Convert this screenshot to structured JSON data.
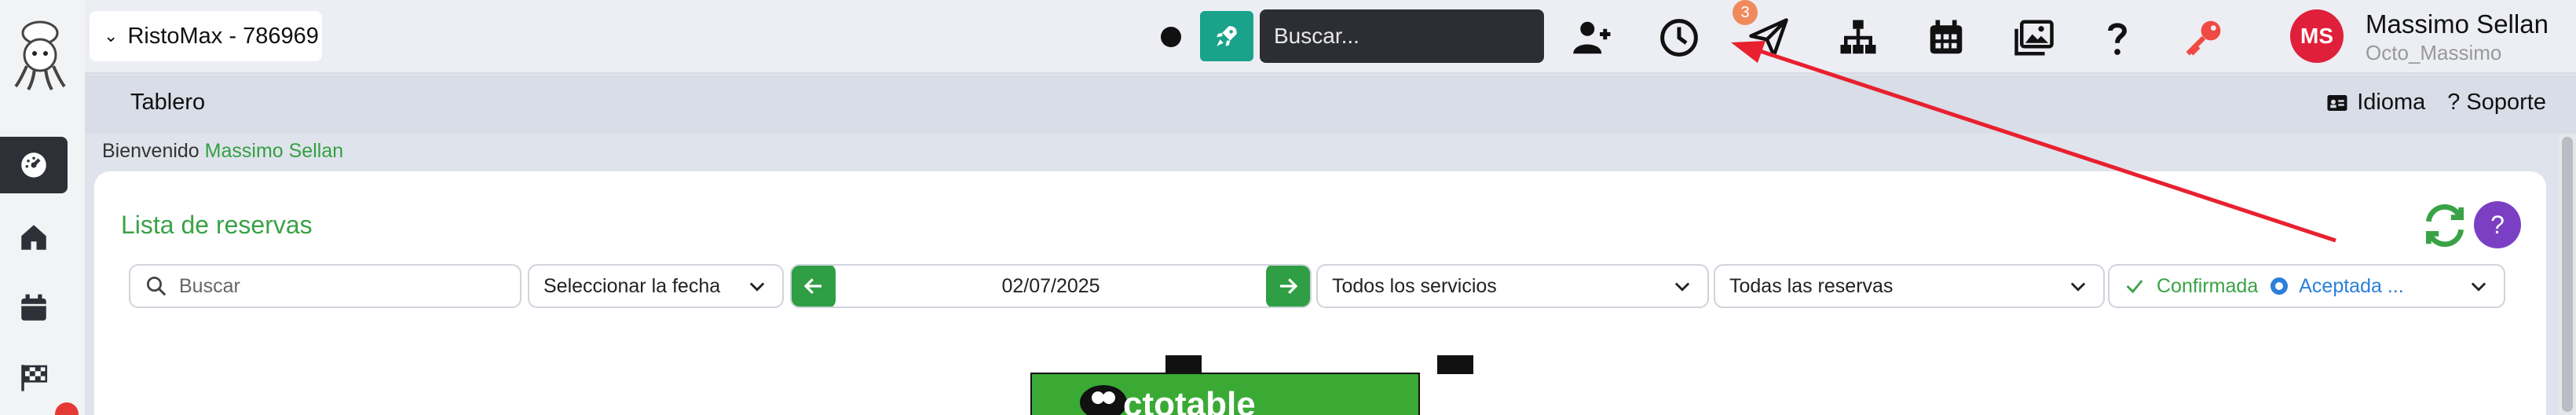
{
  "sidebar": {
    "items": [
      {
        "icon": "dashboard-gauge-icon",
        "active": true
      },
      {
        "icon": "home-icon",
        "active": false
      },
      {
        "icon": "calendar-icon",
        "active": false
      },
      {
        "icon": "checkered-flag-icon",
        "active": false
      }
    ]
  },
  "header": {
    "restaurant_label": "RistoMax - 786969",
    "search_placeholder": "Buscar...",
    "notification_count": "3",
    "avatar_initials": "MS",
    "user_name": "Massimo Sellan",
    "user_handle": "Octo_Massimo"
  },
  "subbar": {
    "title": "Tablero",
    "language_label": "Idioma",
    "support_label": "Soporte"
  },
  "welcome": {
    "prefix": "Bienvenido",
    "name": "Massimo Sellan"
  },
  "reservations": {
    "title": "Lista de reservas",
    "search_placeholder": "Buscar",
    "date_select_label": "Seleccionar la fecha",
    "current_date": "02/07/2025",
    "services_label": "Todos los servicios",
    "reservations_filter_label": "Todas las reservas",
    "status_confirmed": "Confirmada",
    "status_accepted": "Aceptada ..."
  },
  "promo": {
    "text": "ctotable"
  },
  "colors": {
    "brand_green": "#3aa246",
    "accent_teal": "#1aa38a",
    "avatar_red": "#e0203a",
    "help_purple": "#7b3fc4",
    "annotation_red": "#e8202f"
  }
}
